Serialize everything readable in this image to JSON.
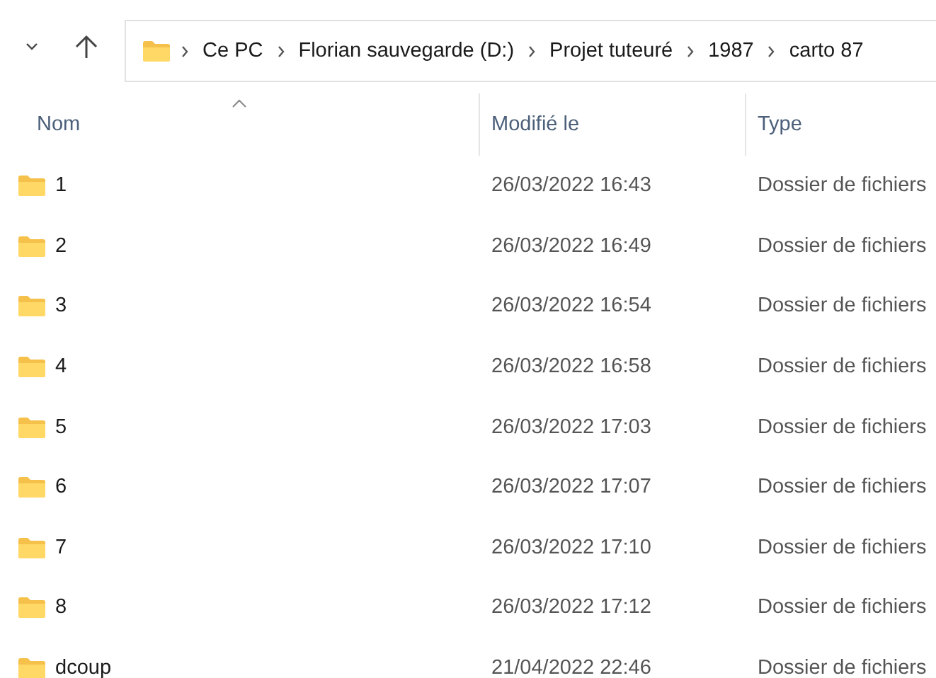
{
  "breadcrumb": [
    "Ce PC",
    "Florian sauvegarde (D:)",
    "Projet tuteuré",
    "1987",
    "carto 87"
  ],
  "table": {
    "columns": [
      {
        "label": "Nom",
        "sorted": true
      },
      {
        "label": "Modifié le",
        "sorted": false
      },
      {
        "label": "Type",
        "sorted": false
      }
    ],
    "rows": [
      {
        "name": "1",
        "modified": "26/03/2022 16:43",
        "type": "Dossier de fichiers"
      },
      {
        "name": "2",
        "modified": "26/03/2022 16:49",
        "type": "Dossier de fichiers"
      },
      {
        "name": "3",
        "modified": "26/03/2022 16:54",
        "type": "Dossier de fichiers"
      },
      {
        "name": "4",
        "modified": "26/03/2022 16:58",
        "type": "Dossier de fichiers"
      },
      {
        "name": "5",
        "modified": "26/03/2022 17:03",
        "type": "Dossier de fichiers"
      },
      {
        "name": "6",
        "modified": "26/03/2022 17:07",
        "type": "Dossier de fichiers"
      },
      {
        "name": "7",
        "modified": "26/03/2022 17:10",
        "type": "Dossier de fichiers"
      },
      {
        "name": "8",
        "modified": "26/03/2022 17:12",
        "type": "Dossier de fichiers"
      },
      {
        "name": "dcoup",
        "modified": "21/04/2022 22:46",
        "type": "Dossier de fichiers"
      }
    ]
  }
}
